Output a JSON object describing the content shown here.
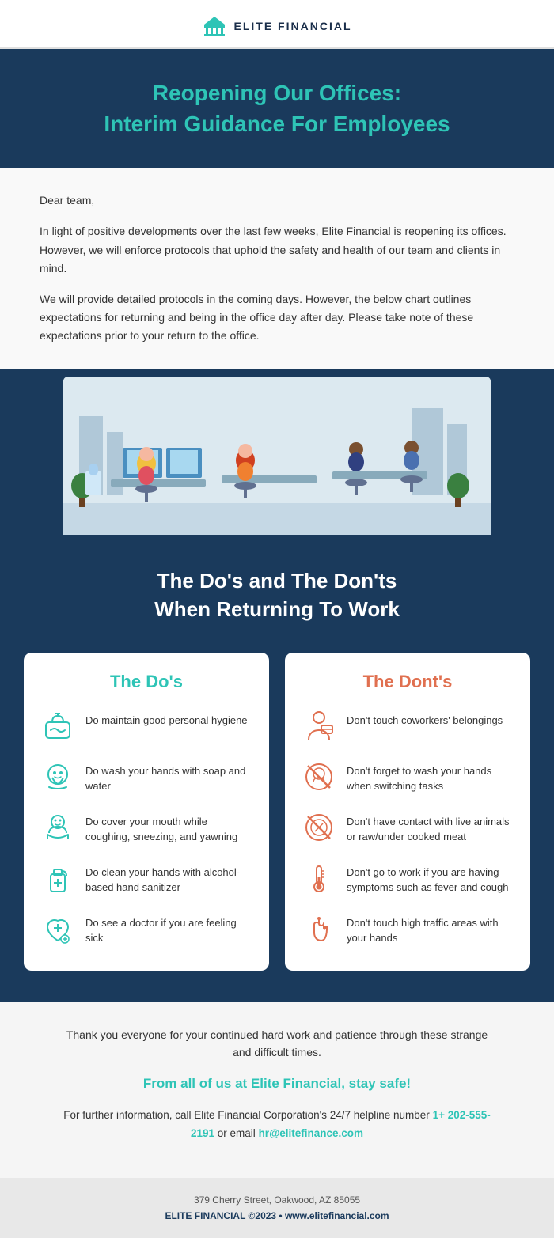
{
  "header": {
    "company": "ELITE FINANCIAL",
    "logo_icon": "bank-icon"
  },
  "hero": {
    "title_line1": "Reopening Our Offices:",
    "title_line2": "Interim Guidance For Employees"
  },
  "body": {
    "greeting": "Dear team,",
    "paragraph1": "In light of positive developments over the last few weeks, Elite Financial is reopening its offices. However, we will enforce protocols that uphold the safety and health of our team and clients in mind.",
    "paragraph2": "We will provide detailed protocols in the coming days. However, the below chart outlines expectations for returning and being in the office day after day. Please take note of these expectations prior to your return to the office."
  },
  "dos_donts": {
    "section_title_line1": "The Do's and The Don'ts",
    "section_title_line2": "When Returning To Work",
    "dos": {
      "title": "The Do's",
      "items": [
        {
          "icon": "hygiene-icon",
          "text": "Do maintain good personal hygiene"
        },
        {
          "icon": "handwash-icon",
          "text": "Do wash your hands with soap and water"
        },
        {
          "icon": "mouth-cover-icon",
          "text": "Do cover your mouth while coughing, sneezing, and yawning"
        },
        {
          "icon": "sanitizer-icon",
          "text": "Do clean your hands with alcohol-based hand sanitizer"
        },
        {
          "icon": "doctor-icon",
          "text": "Do see a doctor if you are feeling sick"
        }
      ]
    },
    "donts": {
      "title": "The Dont's",
      "items": [
        {
          "icon": "belongings-icon",
          "text": "Don't touch coworkers' belongings"
        },
        {
          "icon": "no-handwash-icon",
          "text": "Don't forget to wash your hands when switching tasks"
        },
        {
          "icon": "no-meat-icon",
          "text": "Don't have contact with live animals or raw/under cooked meat"
        },
        {
          "icon": "thermometer-icon",
          "text": "Don't go to work if you are having symptoms such as fever and cough"
        },
        {
          "icon": "no-touch-icon",
          "text": "Don't touch high traffic areas with your hands"
        }
      ]
    }
  },
  "footer": {
    "thank_you": "Thank you everyone for your continued hard work and patience through these strange and difficult times.",
    "tagline": "From all of us at Elite Financial, stay safe!",
    "contact_text": "For further information, call Elite Financial Corporation's 24/7 helpline number",
    "phone": "1+ 202-555-2191",
    "email_prefix": "or email",
    "email": "hr@elitefinance.com"
  },
  "bottom_footer": {
    "address": "379 Cherry Street, Oakwood, AZ 85055",
    "brand_line": "ELITE FINANCIAL ©2023 • www.elitefinancial.com"
  }
}
